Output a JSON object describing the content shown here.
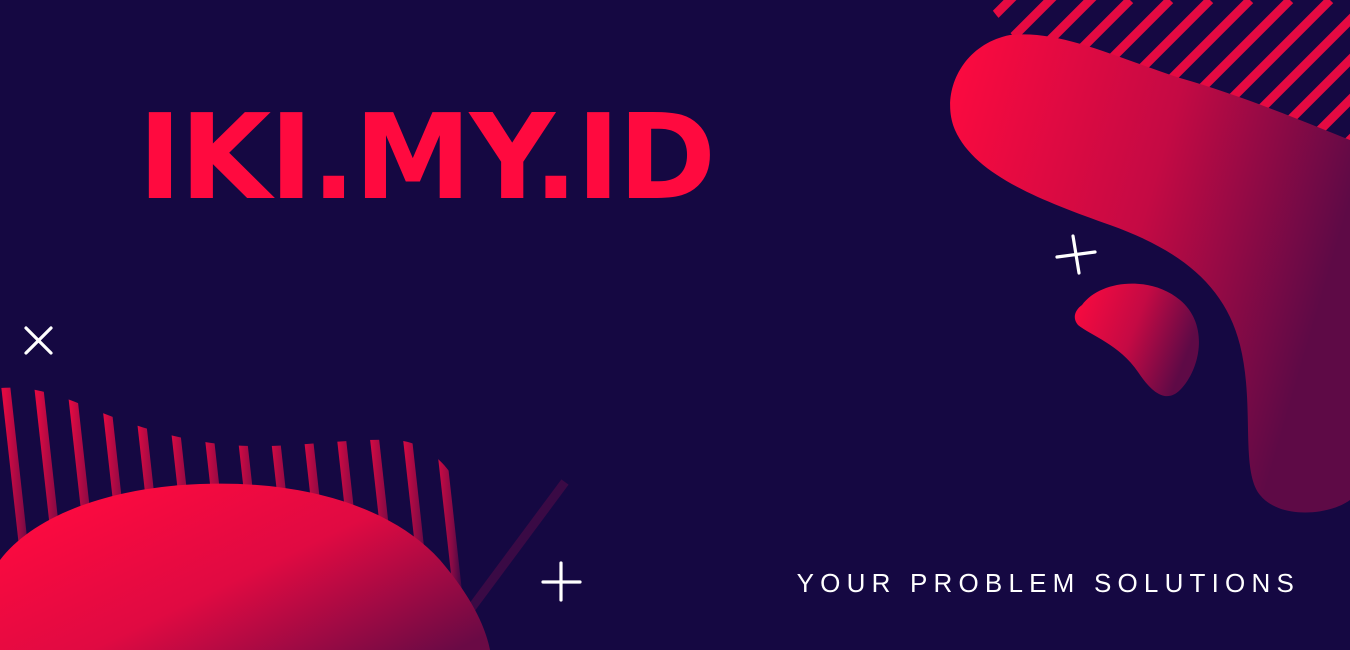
{
  "banner": {
    "title": "IKI.MY.ID",
    "tagline": "YOUR PROBLEM SOLUTIONS"
  },
  "colors": {
    "background": "#150842",
    "accent": "#ff0a3f",
    "accent_dark": "#7a0a45",
    "mark": "#ffffff"
  },
  "icons": [
    "close-icon",
    "plus-icon"
  ]
}
